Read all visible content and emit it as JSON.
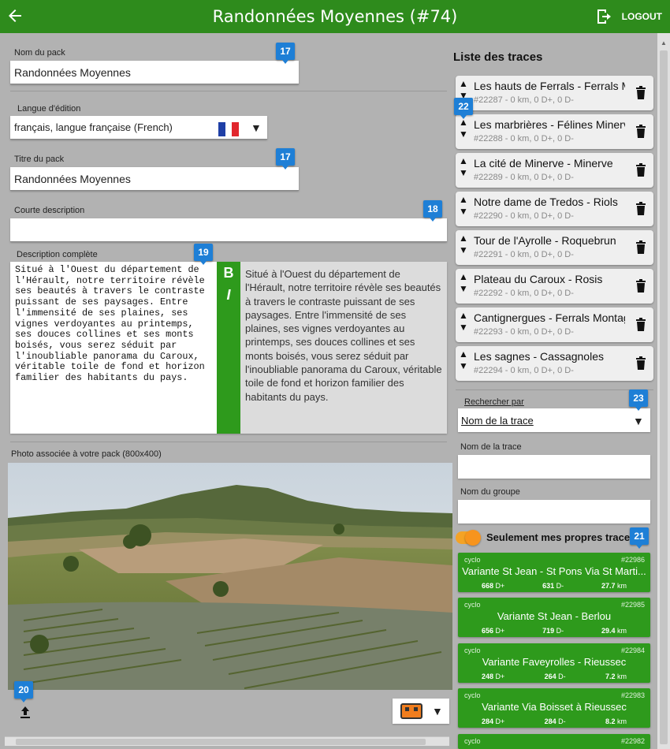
{
  "header": {
    "title": "Randonnées Moyennes (#74)",
    "logout_label": "LOGOUT",
    "color": "#2e8b1c"
  },
  "form": {
    "pack_name_label": "Nom du pack",
    "pack_name_value": "Randonnées Moyennes",
    "language_label": "Langue d'édition",
    "language_value": "français, langue française (French)",
    "title_label": "Titre du pack",
    "title_value": "Randonnées Moyennes",
    "short_desc_label": "Courte description",
    "short_desc_value": "",
    "full_desc_label": "Description complète",
    "full_desc_value": "Situé à l'Ouest du département de l'Hérault, notre territoire révèle ses beautés à travers le contraste puissant de ses paysages. Entre l'immensité de ses plaines, ses vignes verdoyantes au printemps, ses douces collines et ses monts boisés, vous serez séduit par l'inoubliable panorama du Caroux, véritable toile de fond et horizon familier des habitants du pays.",
    "bold_tool": "B",
    "italic_tool": "I",
    "photo_label": "Photo associée à votre pack (800x400)"
  },
  "badges": {
    "pack_name": "17",
    "title": "17",
    "short_desc": "18",
    "full_desc": "19",
    "photo": "20",
    "own_traces": "21",
    "traces": "22",
    "search": "23"
  },
  "traces": {
    "title": "Liste des traces",
    "items": [
      {
        "name": "Les hauts de Ferrals - Ferrals Mon",
        "meta": "#22287 - 0 km, 0 D+, 0 D-"
      },
      {
        "name": "Les marbrières - Félines Minervois",
        "meta": "#22288 - 0 km, 0 D+, 0 D-"
      },
      {
        "name": "La cité de Minerve - Minerve",
        "meta": "#22289 - 0 km, 0 D+, 0 D-"
      },
      {
        "name": "Notre dame de Tredos - Riols",
        "meta": "#22290 - 0 km, 0 D+, 0 D-"
      },
      {
        "name": "Tour de l'Ayrolle - Roquebrun",
        "meta": "#22291 - 0 km, 0 D+, 0 D-"
      },
      {
        "name": "Plateau du Caroux - Rosis",
        "meta": "#22292 - 0 km, 0 D+, 0 D-"
      },
      {
        "name": "Cantignergues - Ferrals Montagne",
        "meta": "#22293 - 0 km, 0 D+, 0 D-"
      },
      {
        "name": "Les sagnes - Cassagnoles",
        "meta": "#22294 - 0 km, 0 D+, 0 D-"
      }
    ]
  },
  "search": {
    "label": "Rechercher par",
    "value": "Nom de la trace",
    "trace_name_label": "Nom de la trace",
    "trace_name_value": "",
    "group_name_label": "Nom du groupe",
    "group_name_value": "",
    "own_traces_label": "Seulement mes propres traces",
    "own_traces_on": true
  },
  "results": [
    {
      "type": "cyclo",
      "id": "#22986",
      "name": "Variante St Jean - St Pons Via St Marti...",
      "dplus": "668",
      "dminus": "631",
      "km": "27.7"
    },
    {
      "type": "cyclo",
      "id": "#22985",
      "name": "Variante St Jean - Berlou",
      "dplus": "656",
      "dminus": "719",
      "km": "29.4"
    },
    {
      "type": "cyclo",
      "id": "#22984",
      "name": "Variante Faveyrolles - Rieussec",
      "dplus": "248",
      "dminus": "264",
      "km": "7.2"
    },
    {
      "type": "cyclo",
      "id": "#22983",
      "name": "Variante Via Boisset à Rieussec",
      "dplus": "284",
      "dminus": "284",
      "km": "8.2"
    },
    {
      "type": "cyclo",
      "id": "#22982",
      "name": "",
      "dplus": "",
      "dminus": "",
      "km": ""
    }
  ],
  "units": {
    "dplus": "D+",
    "dminus": "D-",
    "km": "km"
  }
}
